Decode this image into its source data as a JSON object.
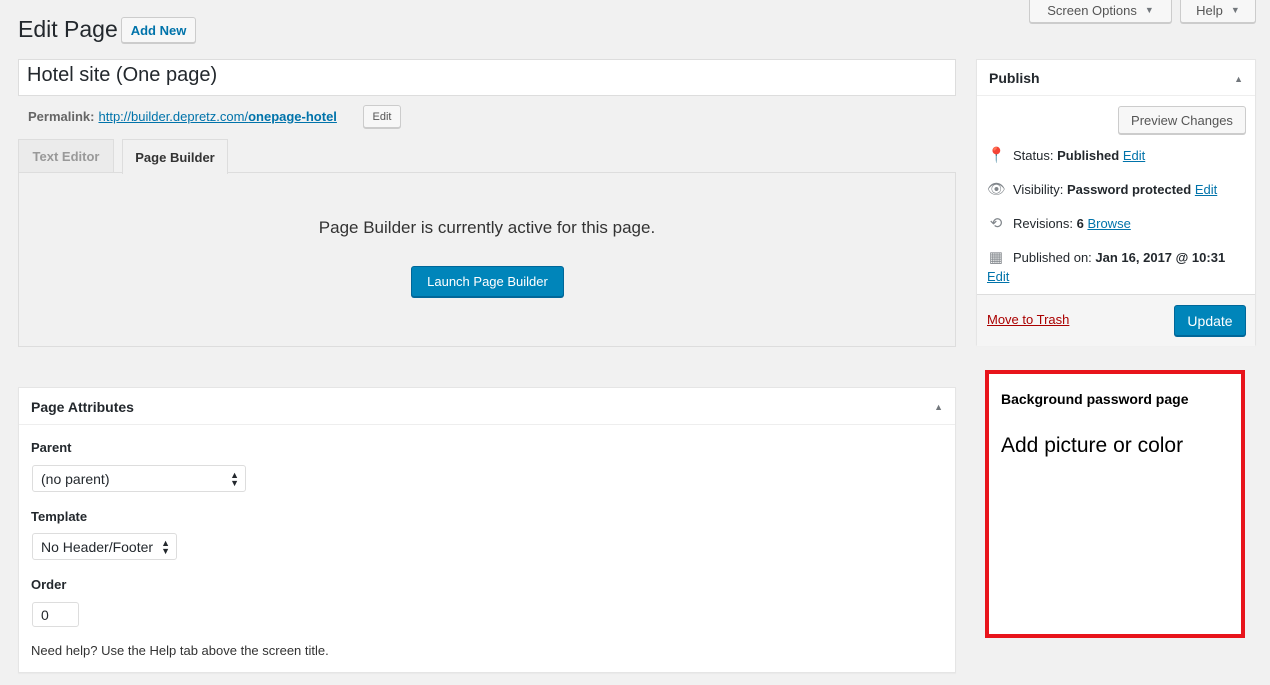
{
  "header": {
    "title": "Edit Page",
    "add_new": "Add New",
    "screen_options": "Screen Options",
    "help": "Help"
  },
  "post": {
    "title": "Hotel site (One page)",
    "permalink_label": "Permalink:",
    "permalink_base": "http://builder.depretz.com/",
    "permalink_slug": "onepage-hotel",
    "edit": "Edit"
  },
  "tabs": [
    {
      "label": "Text Editor",
      "active": false
    },
    {
      "label": "Page Builder",
      "active": true
    }
  ],
  "builder": {
    "message": "Page Builder is currently active for this page.",
    "launch": "Launch Page Builder"
  },
  "attributes": {
    "title": "Page Attributes",
    "parent_label": "Parent",
    "parent_value": "(no parent)",
    "template_label": "Template",
    "template_value": "No Header/Footer",
    "order_label": "Order",
    "order_value": "0",
    "help": "Need help? Use the Help tab above the screen title."
  },
  "publish": {
    "title": "Publish",
    "preview": "Preview Changes",
    "status_label": "Status:",
    "status_value": "Published",
    "visibility_label": "Visibility:",
    "visibility_value": "Password protected",
    "revisions_label": "Revisions:",
    "revisions_value": "6",
    "browse": "Browse",
    "published_label": "Published on:",
    "published_value": "Jan 16, 2017 @ 10:31",
    "edit": "Edit",
    "trash": "Move to Trash",
    "update": "Update"
  },
  "annotation": {
    "title": "Background password page",
    "text": "Add picture or color",
    "border_color": "#e8141b"
  },
  "colors": {
    "accent": "#0085ba",
    "link": "#0073aa",
    "trash": "#a00"
  }
}
